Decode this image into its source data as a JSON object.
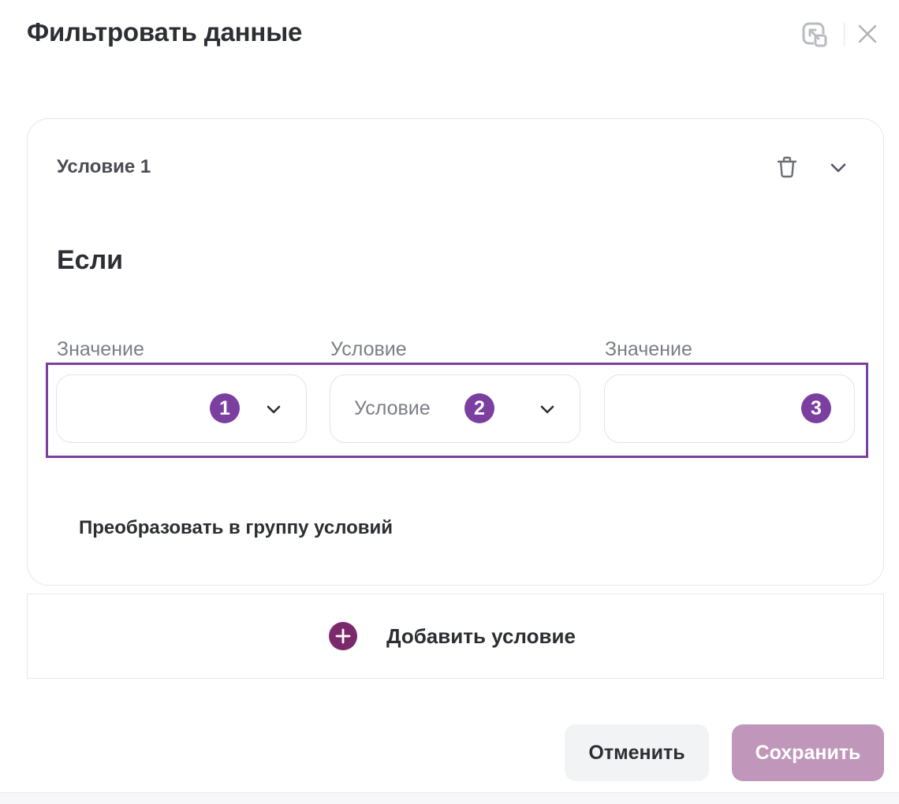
{
  "dialog": {
    "title": "Фильтровать данные"
  },
  "condition": {
    "title": "Условие 1",
    "if_label": "Если",
    "fields": [
      {
        "label": "Значение",
        "value": "",
        "badge": "1",
        "has_dropdown": true
      },
      {
        "label": "Условие",
        "placeholder": "Условие",
        "badge": "2",
        "has_dropdown": true
      },
      {
        "label": "Значение",
        "value": "",
        "badge": "3",
        "has_dropdown": false
      }
    ],
    "convert_link": "Преобразовать в группу условий"
  },
  "add_condition": {
    "label": "Добавить условие"
  },
  "actions": {
    "cancel_label": "Отменить",
    "save_label": "Сохранить"
  },
  "colors": {
    "accent": "#7b3fa0",
    "add_icon": "#7a2a6b",
    "save_button": "#c097bb",
    "cancel_button": "#f2f3f5"
  },
  "icons": {
    "collapse": "collapse-arrow-icon",
    "close": "close-icon",
    "delete": "trash-icon",
    "expand": "chevron-down-icon",
    "add": "plus-circle-icon"
  }
}
